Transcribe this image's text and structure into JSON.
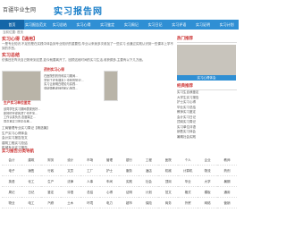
{
  "header": {
    "logo": "百疆毕业生网",
    "site_name": "实习报告网"
  },
  "nav": [
    "首页",
    "实习报告范文",
    "实习总结",
    "实习心得",
    "实习鉴定",
    "实习周记",
    "实习日记",
    "实习评语",
    "实习证明",
    "实习计划"
  ],
  "breadcrumb": "当前位置: 首页",
  "main": {
    "sec1_title": "实习心得【通用】",
    "sec1_text": "一是专业知识,不足的是在实践中体会到专业知识的重要性;毕业以来我多次参加了一些实习,也通过实践认识到一些课本上学不到的东西。",
    "sec2_title": "实习总结",
    "sec2_text": "仿佛还在昨天自己刚来到这里,如今就要离开了。回顾这段时间的实习生活,收获颇多,主要有以下几方面。",
    "block1": {
      "title": "药剂实习心得",
      "lines": [
        "在医院的药剂科实习期间…",
        "学到了许多课本上没有的知识…",
        "实习让我明白理论与实践…",
        "感谢带教老师的耐心指导…"
      ]
    },
    "block2": {
      "title": "生产实习单位鉴定",
      "lines": [
        "该同学在实习期间表现良好…",
        "能按时完成各项工作任务…",
        "工作认真负责,态度端正…",
        "同意其实习鉴定合格…"
      ]
    },
    "links": [
      "工商管理专业实习周记【精选篇】",
      "生产实习心得体会",
      "会计实习报告范文",
      "建筑工程实习总结",
      "机械专业实习报告"
    ]
  },
  "side": {
    "hot_title": "热门推荐",
    "img_caption": "实习心得体会",
    "list_title": "经典推荐",
    "items": [
      "实习生自我鉴定",
      "大学生实习报告",
      "护士实习心得",
      "毕业实习总结",
      "教师实习鉴定",
      "会计实习日记",
      "顶岗实习周记",
      "实习单位评语",
      "销售实习体会",
      "暑期社会实践"
    ]
  },
  "bottom": {
    "title": "实习报告分类导航",
    "cells": [
      "会计",
      "建筑",
      "财务",
      "设计",
      "市场",
      "管理",
      "银行",
      "工程",
      "医院",
      "个人",
      "企业",
      "教师",
      "电子",
      "销售",
      "行政",
      "文员",
      "工厂",
      "护士",
      "服务",
      "酒店",
      "机械",
      "计算机",
      "物流",
      "药剂",
      "英语",
      "化工",
      "生产",
      "法律",
      "人事",
      "车间",
      "实践",
      "社会",
      "顶岗",
      "毕业",
      "大学",
      "暑期",
      "周记",
      "日记",
      "鉴定",
      "评语",
      "总结",
      "心得",
      "证明",
      "计划",
      "范文",
      "格式",
      "模板",
      "通用",
      "物业",
      "电工",
      "汽修",
      "土木",
      "环境",
      "电力",
      "超市",
      "保险",
      "商务",
      "外贸",
      "网络",
      "营销"
    ]
  }
}
